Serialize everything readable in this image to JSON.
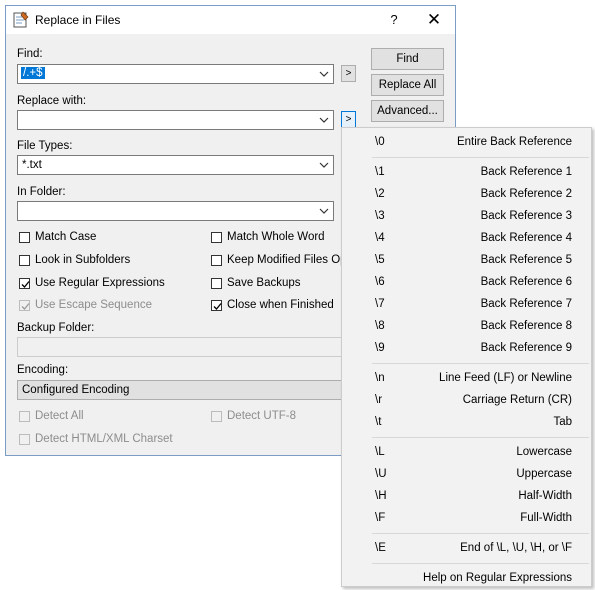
{
  "dialog": {
    "title": "Replace in Files",
    "help_glyph": "?",
    "close_glyph": "✕",
    "find": {
      "label": "Find:",
      "value": "/.+$"
    },
    "replace": {
      "label": "Replace with:",
      "value": ""
    },
    "file_types": {
      "label": "File Types:",
      "value": "*.txt"
    },
    "folder": {
      "label": "In Folder:",
      "value": ""
    },
    "arrow_button": ">",
    "buttons": {
      "find": "Find",
      "replace_all": "Replace All",
      "advanced": "Advanced..."
    },
    "options": {
      "match_case": {
        "label": "Match Case",
        "checked": false
      },
      "match_whole_word": {
        "label": "Match Whole Word",
        "checked": false
      },
      "look_in_subfolders": {
        "label": "Look in Subfolders",
        "checked": false
      },
      "keep_modified": {
        "label": "Keep Modified Files Ope",
        "checked": false
      },
      "use_regex": {
        "label": "Use Regular Expressions",
        "checked": true
      },
      "save_backups": {
        "label": "Save Backups",
        "checked": false
      },
      "use_escape": {
        "label": "Use Escape Sequence",
        "checked": true,
        "disabled": true
      },
      "close_when_finished": {
        "label": "Close when Finished",
        "checked": true
      }
    },
    "backup_folder": {
      "label": "Backup Folder:"
    },
    "encoding": {
      "label": "Encoding:",
      "value": "Configured Encoding"
    },
    "detect": {
      "all": "Detect All",
      "utf8": "Detect UTF-8",
      "html": "Detect HTML/XML Charset"
    }
  },
  "menu": {
    "groups": [
      [
        {
          "code": "\\0",
          "desc": "Entire Back Reference"
        }
      ],
      [
        {
          "code": "\\1",
          "desc": "Back Reference 1"
        },
        {
          "code": "\\2",
          "desc": "Back Reference 2"
        },
        {
          "code": "\\3",
          "desc": "Back Reference 3"
        },
        {
          "code": "\\4",
          "desc": "Back Reference 4"
        },
        {
          "code": "\\5",
          "desc": "Back Reference 5"
        },
        {
          "code": "\\6",
          "desc": "Back Reference 6"
        },
        {
          "code": "\\7",
          "desc": "Back Reference 7"
        },
        {
          "code": "\\8",
          "desc": "Back Reference 8"
        },
        {
          "code": "\\9",
          "desc": "Back Reference 9"
        }
      ],
      [
        {
          "code": "\\n",
          "desc": "Line Feed (LF) or Newline"
        },
        {
          "code": "\\r",
          "desc": "Carriage Return (CR)"
        },
        {
          "code": "\\t",
          "desc": "Tab"
        }
      ],
      [
        {
          "code": "\\L",
          "desc": "Lowercase"
        },
        {
          "code": "\\U",
          "desc": "Uppercase"
        },
        {
          "code": "\\H",
          "desc": "Half-Width"
        },
        {
          "code": "\\F",
          "desc": "Full-Width"
        }
      ],
      [
        {
          "code": "\\E",
          "desc": "End of \\L, \\U, \\H,  or \\F"
        }
      ],
      [
        {
          "code": "",
          "desc": "Help on Regular Expressions"
        }
      ]
    ]
  }
}
